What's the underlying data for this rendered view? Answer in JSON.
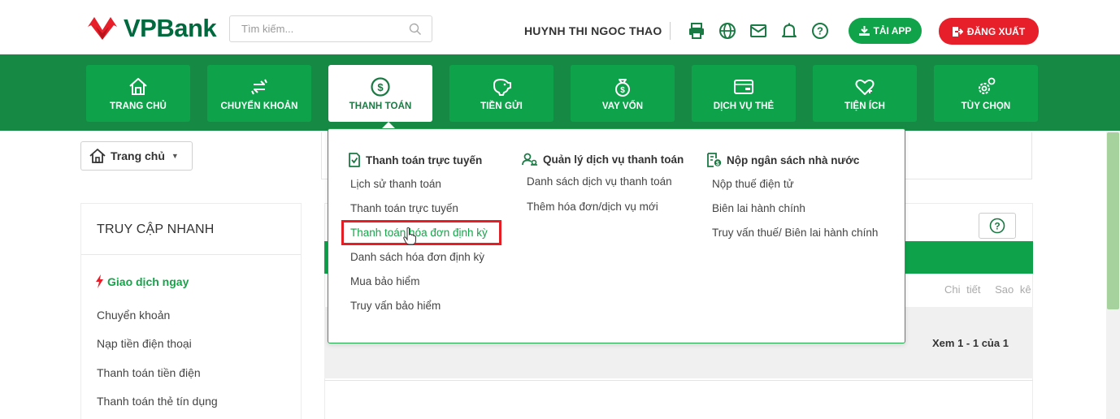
{
  "brand": {
    "name": "VPBank",
    "logo_color": "#00693e",
    "mark_color": "#e61f2a"
  },
  "search": {
    "placeholder": "Tìm kiếm...",
    "icon": "search-icon"
  },
  "user": {
    "name": "HUYNH THI NGOC THAO"
  },
  "header_icons": [
    "printer-icon",
    "globe-icon",
    "mail-icon",
    "bell-icon",
    "help-icon"
  ],
  "header_buttons": {
    "download_app": "TẢI APP",
    "logout": "ĐĂNG XUẤT"
  },
  "colors": {
    "nav_bg": "#168a45",
    "nav_item": "#0ea24b",
    "accent_green": "#17a34a",
    "logout_red": "#e61f2a",
    "highlight_red": "#e31e24"
  },
  "nav": [
    {
      "label": "TRANG CHỦ",
      "icon": "home-icon",
      "active": false
    },
    {
      "label": "CHUYỂN KHOẢN",
      "icon": "transfer-icon",
      "active": false
    },
    {
      "label": "THANH TOÁN",
      "icon": "dollar-coin-icon",
      "active": true
    },
    {
      "label": "TIỀN GỬI",
      "icon": "piggy-bank-icon",
      "active": false
    },
    {
      "label": "VAY VỐN",
      "icon": "money-bag-icon",
      "active": false
    },
    {
      "label": "DỊCH VỤ THẺ",
      "icon": "card-icon",
      "active": false
    },
    {
      "label": "TIỆN ÍCH",
      "icon": "heart-plus-icon",
      "active": false
    },
    {
      "label": "TÙY CHỌN",
      "icon": "settings-icon",
      "active": false
    }
  ],
  "breadcrumb": {
    "label": "Trang chủ",
    "caret": "▼"
  },
  "quick_access": {
    "title": "TRUY CẬP NHANH",
    "heading": "Giao dịch ngay",
    "links": [
      "Chuyển khoản",
      "Nạp tiền điện thoại",
      "Thanh toán tiền điện",
      "Thanh toán thẻ tín dụng"
    ]
  },
  "panel": {
    "links": [
      "Chi tiết",
      "Sao kê"
    ],
    "pager": "Xem 1 - 1 của 1"
  },
  "dropdown": {
    "columns": [
      {
        "title": "Thanh toán trực tuyến",
        "icon": "document-check-icon",
        "items": [
          "Lịch sử thanh toán",
          "Thanh toán trực tuyến",
          "Thanh toán hóa đơn định kỳ",
          "Danh sách hóa đơn định kỳ",
          "Mua bảo hiểm",
          "Truy vấn bảo hiểm"
        ]
      },
      {
        "title": "Quản lý dịch vụ thanh toán",
        "icon": "user-settings-icon",
        "items": [
          "Danh sách dịch vụ thanh toán",
          "Thêm hóa đơn/dịch vụ mới"
        ]
      },
      {
        "title": "Nộp ngân sách nhà nước",
        "icon": "tax-document-icon",
        "items": [
          "Nộp thuế điện tử",
          "Biên lai hành chính",
          "Truy vấn thuế/ Biên lai hành chính"
        ]
      }
    ],
    "highlighted_item": "Thanh toán hóa đơn định kỳ"
  }
}
